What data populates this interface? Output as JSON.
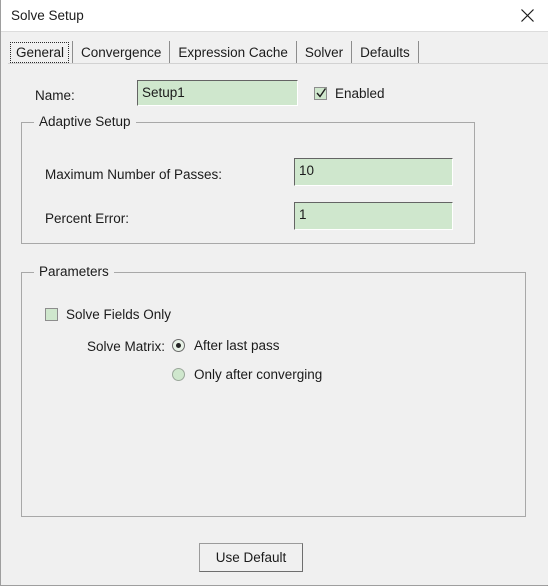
{
  "window": {
    "title": "Solve Setup",
    "close_icon": "close-x-icon"
  },
  "tabs": [
    {
      "label": "General",
      "active": true
    },
    {
      "label": "Convergence",
      "active": false
    },
    {
      "label": "Expression Cache",
      "active": false
    },
    {
      "label": "Solver",
      "active": false
    },
    {
      "label": "Defaults",
      "active": false
    }
  ],
  "general": {
    "name_label": "Name:",
    "name_value": "Setup1",
    "enabled_label": "Enabled",
    "enabled_checked": "checked",
    "adaptive_setup": {
      "title": "Adaptive Setup",
      "max_passes_label": "Maximum Number of Passes:",
      "max_passes_value": "10",
      "percent_error_label": "Percent Error:",
      "percent_error_value": "1"
    },
    "parameters": {
      "title": "Parameters",
      "solve_fields_only_label": "Solve Fields Only",
      "solve_fields_only_checked": "unchecked",
      "solve_matrix_label": "Solve Matrix:",
      "solve_matrix_options": [
        {
          "label": "After last pass",
          "selected": true
        },
        {
          "label": "Only after converging",
          "selected": false
        }
      ]
    }
  },
  "footer": {
    "use_default_label": "Use Default"
  },
  "colors": {
    "dialog_bg": "#f0f0f0",
    "titlebar_bg": "#ffffff",
    "field_bg": "#cfe7cd",
    "text": "#1b1b1b",
    "group_border": "#a8a8a8"
  }
}
